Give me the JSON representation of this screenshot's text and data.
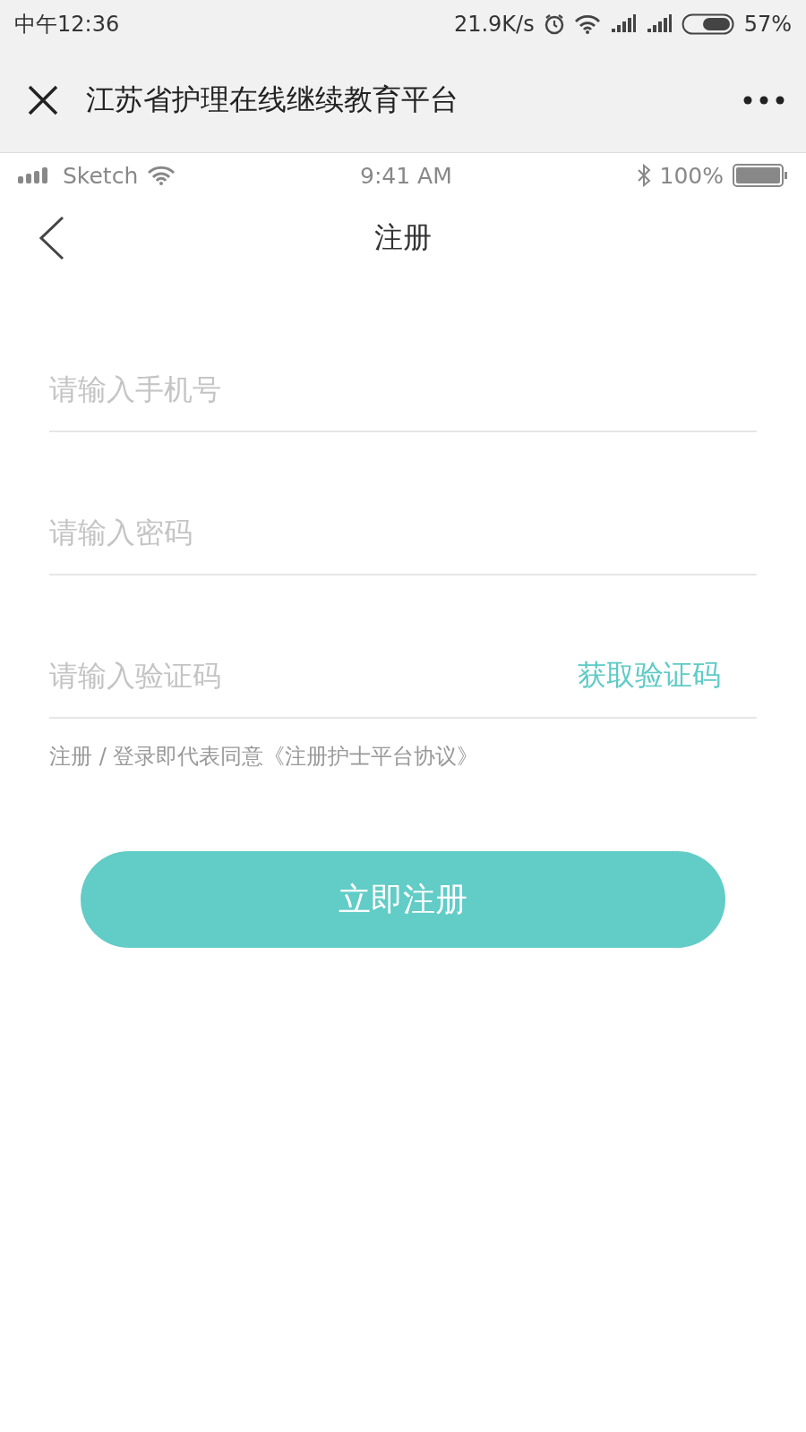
{
  "system_status_bar": {
    "time": "中午12:36",
    "speed": "21.9K/s",
    "battery": "57%"
  },
  "browser_bar": {
    "title": "江苏省护理在线继续教育平台"
  },
  "app_status_bar": {
    "carrier": "Sketch",
    "time": "9:41 AM",
    "battery": "100%"
  },
  "header": {
    "title": "注册"
  },
  "fields": [
    {
      "placeholder": "请输入手机号"
    },
    {
      "placeholder": "请输入密码"
    },
    {
      "placeholder": "请输入验证码",
      "action": "获取验证码"
    }
  ],
  "agreement": "注册 / 登录即代表同意《注册护士平台协议》",
  "submit_button": "立即注册"
}
